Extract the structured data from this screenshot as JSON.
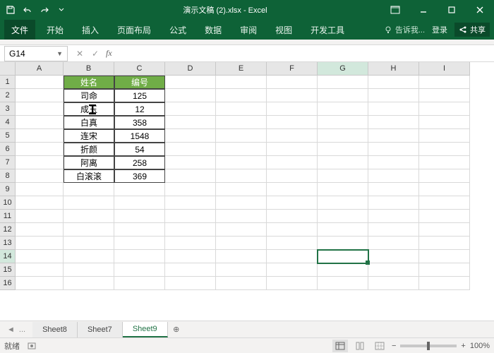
{
  "titlebar": {
    "title": "演示文稿 (2).xlsx - Excel"
  },
  "ribbon": {
    "file": "文件",
    "tabs": [
      "开始",
      "插入",
      "页面布局",
      "公式",
      "数据",
      "审阅",
      "视图",
      "开发工具"
    ],
    "tell_me": "告诉我...",
    "login": "登录",
    "share": "共享"
  },
  "namebox": "G14",
  "columns": [
    "A",
    "B",
    "C",
    "D",
    "E",
    "F",
    "G",
    "H",
    "I"
  ],
  "table": {
    "headers": [
      "姓名",
      "编号"
    ],
    "rows": [
      {
        "name": "司命",
        "num": "125"
      },
      {
        "name": "成玉",
        "num": "12"
      },
      {
        "name": "白真",
        "num": "358"
      },
      {
        "name": "连宋",
        "num": "1548"
      },
      {
        "name": "折颜",
        "num": "54"
      },
      {
        "name": "阿离",
        "num": "258"
      },
      {
        "name": "白滚滚",
        "num": "369"
      }
    ]
  },
  "sheets": {
    "tabs": [
      "Sheet8",
      "Sheet7",
      "Sheet9"
    ],
    "active": 2,
    "ellipsis": "..."
  },
  "status": {
    "ready": "就绪",
    "zoom": "100%",
    "minus": "−",
    "plus": "+"
  }
}
